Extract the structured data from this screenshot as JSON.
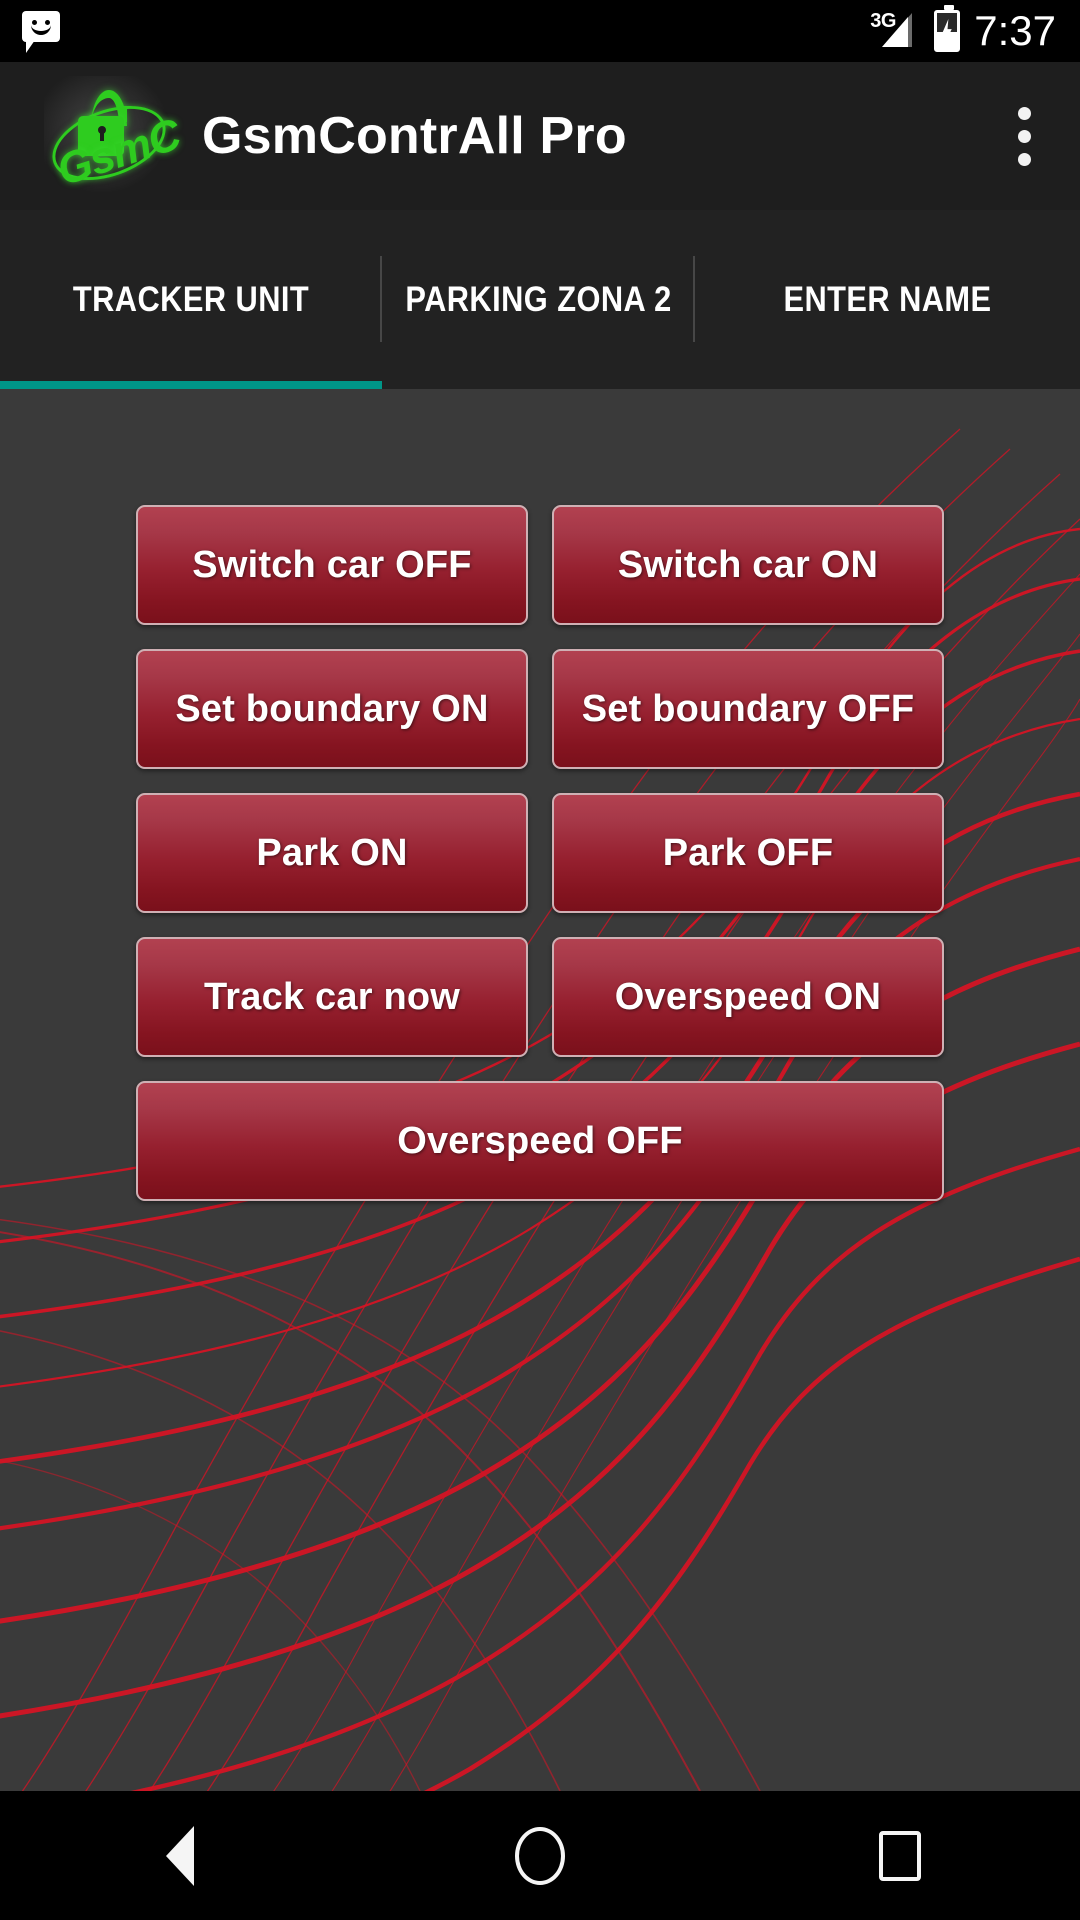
{
  "status_bar": {
    "notification_icon": "sms-smiley-icon",
    "network_type": "3G",
    "signal_icon": "signal-bars-icon",
    "battery_icon": "battery-charging-icon",
    "time": "7:37"
  },
  "app_bar": {
    "logo_icon": "gsmc-padlock-logo",
    "logo_text": "GsmC",
    "title": "GsmContrAll Pro",
    "overflow_icon": "overflow-menu-icon"
  },
  "tabs": {
    "active_index": 0,
    "indicator_color": "#009688",
    "items": [
      {
        "label": "TRACKER UNIT"
      },
      {
        "label": "PARKING ZONA 2"
      },
      {
        "label": "ENTER NAME"
      }
    ]
  },
  "main": {
    "background_color": "#3a3a3a",
    "accent_color": "#a6293a",
    "rows": [
      {
        "buttons": [
          {
            "label": "Switch car OFF"
          },
          {
            "label": "Switch car ON"
          }
        ]
      },
      {
        "buttons": [
          {
            "label": "Set boundary ON"
          },
          {
            "label": "Set boundary OFF"
          }
        ]
      },
      {
        "buttons": [
          {
            "label": "Park ON"
          },
          {
            "label": "Park OFF"
          }
        ]
      },
      {
        "buttons": [
          {
            "label": "Track car now"
          },
          {
            "label": "Overspeed ON"
          }
        ]
      }
    ],
    "wide_button": {
      "label": "Overspeed OFF"
    }
  },
  "nav_bar": {
    "back_icon": "back-triangle-icon",
    "home_icon": "home-circle-icon",
    "recents_icon": "recents-square-icon"
  }
}
